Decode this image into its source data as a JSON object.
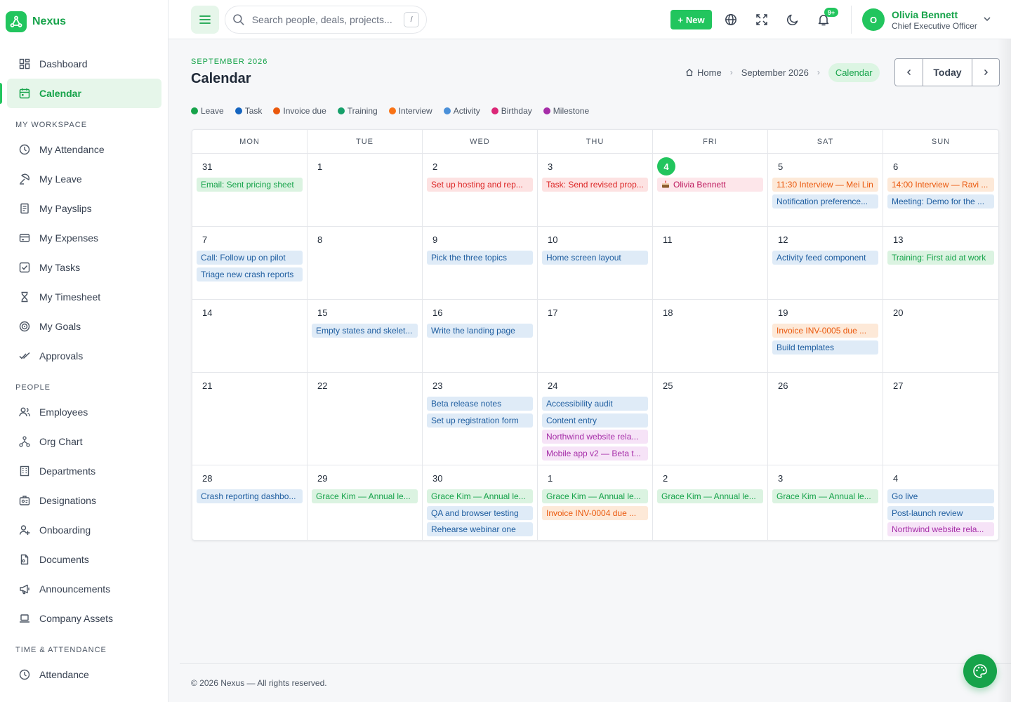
{
  "brand": {
    "name": "Nexus"
  },
  "sidebar": {
    "items": [
      {
        "type": "item",
        "label": "Dashboard",
        "icon": "dashboard-icon",
        "active": false
      },
      {
        "type": "item",
        "label": "Calendar",
        "icon": "calendar-icon",
        "active": true
      },
      {
        "type": "section",
        "label": "MY WORKSPACE"
      },
      {
        "type": "item",
        "label": "My Attendance",
        "icon": "clock-icon"
      },
      {
        "type": "item",
        "label": "My Leave",
        "icon": "leave-icon"
      },
      {
        "type": "item",
        "label": "My Payslips",
        "icon": "payslip-icon"
      },
      {
        "type": "item",
        "label": "My Expenses",
        "icon": "card-icon"
      },
      {
        "type": "item",
        "label": "My Tasks",
        "icon": "checkbox-icon"
      },
      {
        "type": "item",
        "label": "My Timesheet",
        "icon": "hourglass-icon"
      },
      {
        "type": "item",
        "label": "My Goals",
        "icon": "target-icon"
      },
      {
        "type": "item",
        "label": "Approvals",
        "icon": "double-check-icon"
      },
      {
        "type": "section",
        "label": "PEOPLE"
      },
      {
        "type": "item",
        "label": "Employees",
        "icon": "users-icon"
      },
      {
        "type": "item",
        "label": "Org Chart",
        "icon": "org-chart-icon"
      },
      {
        "type": "item",
        "label": "Departments",
        "icon": "building-icon"
      },
      {
        "type": "item",
        "label": "Designations",
        "icon": "badge-icon"
      },
      {
        "type": "item",
        "label": "Onboarding",
        "icon": "user-plus-icon"
      },
      {
        "type": "item",
        "label": "Documents",
        "icon": "document-icon"
      },
      {
        "type": "item",
        "label": "Announcements",
        "icon": "megaphone-icon"
      },
      {
        "type": "item",
        "label": "Company Assets",
        "icon": "laptop-icon"
      },
      {
        "type": "section",
        "label": "TIME & ATTENDANCE"
      },
      {
        "type": "item",
        "label": "Attendance",
        "icon": "clock-icon"
      }
    ]
  },
  "header": {
    "search_placeholder": "Search people, deals, projects...",
    "search_shortcut": "/",
    "new_label": "New",
    "notifications_badge": "9+",
    "user": {
      "initial": "O",
      "name": "Olivia Bennett",
      "role": "Chief Executive Officer"
    }
  },
  "page": {
    "kicker": "SEPTEMBER 2026",
    "title": "Calendar",
    "breadcrumb": {
      "home": "Home",
      "month": "September 2026",
      "current": "Calendar"
    },
    "today_label": "Today"
  },
  "legend": [
    {
      "label": "Leave",
      "color": "#16a34a"
    },
    {
      "label": "Task",
      "color": "#1565c0"
    },
    {
      "label": "Invoice due",
      "color": "#ea580c"
    },
    {
      "label": "Training",
      "color": "#16a06a"
    },
    {
      "label": "Interview",
      "color": "#f97316"
    },
    {
      "label": "Activity",
      "color": "#4a90d9"
    },
    {
      "label": "Birthday",
      "color": "#db2777"
    },
    {
      "label": "Milestone",
      "color": "#a62da8"
    }
  ],
  "calendar": {
    "weekdays": [
      "MON",
      "TUE",
      "WED",
      "THU",
      "FRI",
      "SAT",
      "SUN"
    ],
    "weeks": [
      {
        "days": [
          {
            "num": "31",
            "events": [
              {
                "text": "Email: Sent pricing sheet",
                "color": "green"
              }
            ]
          },
          {
            "num": "1",
            "events": []
          },
          {
            "num": "2",
            "events": [
              {
                "text": "Set up hosting and rep...",
                "color": "red"
              }
            ]
          },
          {
            "num": "3",
            "events": [
              {
                "text": "Task: Send revised prop...",
                "color": "red"
              }
            ]
          },
          {
            "num": "4",
            "today": true,
            "events": [
              {
                "text": "Olivia Bennett",
                "color": "pink",
                "icon": "cake-icon"
              }
            ]
          },
          {
            "num": "5",
            "events": [
              {
                "text": "11:30 Interview — Mei Lin",
                "color": "orange"
              },
              {
                "text": "Notification preference...",
                "color": "blue"
              }
            ]
          },
          {
            "num": "6",
            "events": [
              {
                "text": "14:00 Interview — Ravi ...",
                "color": "orange"
              },
              {
                "text": "Meeting: Demo for the ...",
                "color": "blue"
              }
            ]
          }
        ]
      },
      {
        "days": [
          {
            "num": "7",
            "events": [
              {
                "text": "Call: Follow up on pilot",
                "color": "blue"
              },
              {
                "text": "Triage new crash reports",
                "color": "blue"
              }
            ]
          },
          {
            "num": "8",
            "events": []
          },
          {
            "num": "9",
            "events": [
              {
                "text": "Pick the three topics",
                "color": "blue"
              }
            ]
          },
          {
            "num": "10",
            "events": [
              {
                "text": "Home screen layout",
                "color": "blue"
              }
            ]
          },
          {
            "num": "11",
            "events": []
          },
          {
            "num": "12",
            "events": [
              {
                "text": "Activity feed component",
                "color": "blue"
              }
            ]
          },
          {
            "num": "13",
            "events": [
              {
                "text": "Training: First aid at work",
                "color": "green"
              }
            ]
          }
        ]
      },
      {
        "days": [
          {
            "num": "14",
            "events": []
          },
          {
            "num": "15",
            "events": [
              {
                "text": "Empty states and skelet...",
                "color": "blue"
              }
            ]
          },
          {
            "num": "16",
            "events": [
              {
                "text": "Write the landing page",
                "color": "blue"
              }
            ]
          },
          {
            "num": "17",
            "events": []
          },
          {
            "num": "18",
            "events": []
          },
          {
            "num": "19",
            "events": [
              {
                "text": "Invoice INV-0005 due ...",
                "color": "orange"
              },
              {
                "text": "Build templates",
                "color": "blue"
              }
            ]
          },
          {
            "num": "20",
            "events": []
          }
        ]
      },
      {
        "days": [
          {
            "num": "21",
            "events": []
          },
          {
            "num": "22",
            "events": []
          },
          {
            "num": "23",
            "events": [
              {
                "text": "Beta release notes",
                "color": "blue"
              },
              {
                "text": "Set up registration form",
                "color": "blue"
              }
            ]
          },
          {
            "num": "24",
            "events": [
              {
                "text": "Accessibility audit",
                "color": "blue"
              },
              {
                "text": "Content entry",
                "color": "blue"
              },
              {
                "text": "Northwind website rela...",
                "color": "purple"
              },
              {
                "text": "Mobile app v2 — Beta t...",
                "color": "purple"
              }
            ]
          },
          {
            "num": "25",
            "events": []
          },
          {
            "num": "26",
            "events": []
          },
          {
            "num": "27",
            "events": []
          }
        ]
      },
      {
        "days": [
          {
            "num": "28",
            "events": [
              {
                "text": "Crash reporting dashbo...",
                "color": "blue"
              }
            ]
          },
          {
            "num": "29",
            "events": [
              {
                "text": "Grace Kim — Annual le...",
                "color": "green"
              }
            ]
          },
          {
            "num": "30",
            "events": [
              {
                "text": "Grace Kim — Annual le...",
                "color": "green"
              },
              {
                "text": "QA and browser testing",
                "color": "blue"
              },
              {
                "text": "Rehearse webinar one",
                "color": "blue"
              }
            ]
          },
          {
            "num": "1",
            "events": [
              {
                "text": "Grace Kim — Annual le...",
                "color": "green"
              },
              {
                "text": "Invoice INV-0004 due ...",
                "color": "orange"
              }
            ]
          },
          {
            "num": "2",
            "events": [
              {
                "text": "Grace Kim — Annual le...",
                "color": "green"
              }
            ]
          },
          {
            "num": "3",
            "events": [
              {
                "text": "Grace Kim — Annual le...",
                "color": "green"
              }
            ]
          },
          {
            "num": "4",
            "events": [
              {
                "text": "Go live",
                "color": "blue"
              },
              {
                "text": "Post-launch review",
                "color": "blue"
              },
              {
                "text": "Northwind website rela...",
                "color": "purple"
              }
            ]
          }
        ]
      }
    ]
  },
  "footer": {
    "text": "© 2026 Nexus — All rights reserved."
  }
}
